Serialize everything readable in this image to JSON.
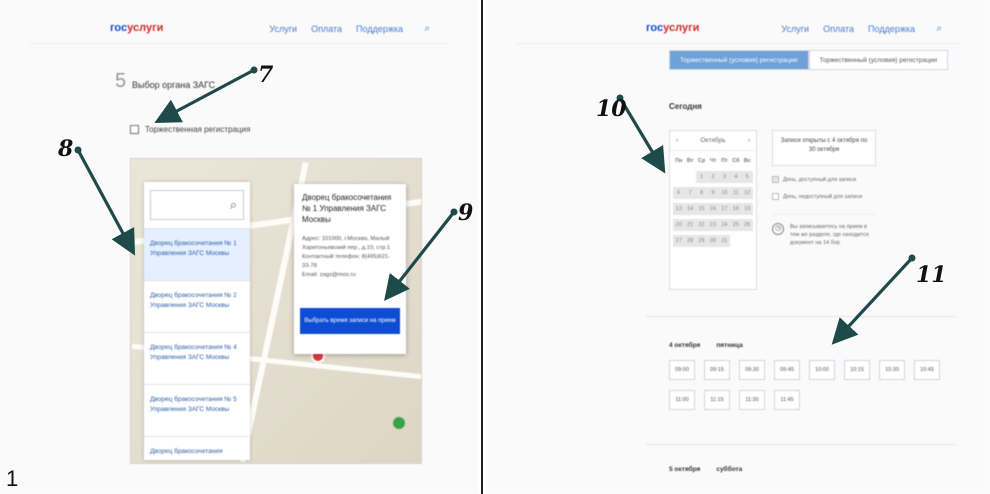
{
  "figure_label": "1",
  "colors": {
    "brand_blue": "#0d4cd3",
    "brand_red": "#d12c2c",
    "arrow": "#1f4a4a",
    "tab_active": "#6fa0d8"
  },
  "header": {
    "logo_prefix": "гос",
    "logo_suffix": "услуги",
    "nav": [
      "Услуги",
      "Оплата",
      "Поддержка"
    ],
    "search_icon": "search-icon"
  },
  "left": {
    "step_number": "5",
    "step_title": "Выбор органа ЗАГС",
    "checkbox_label": "Торжественная регистрация",
    "list_items": [
      "Дворец бракосочетания № 1 Управления ЗАГС Москвы",
      "Дворец бракосочетания № 2 Управления ЗАГС Москвы",
      "Дворец бракосочетания № 4 Управления ЗАГС Москвы",
      "Дворец бракосочетания № 5 Управления ЗАГС Москвы",
      "Дворец бракосочетания"
    ],
    "popup": {
      "title": "Дворец бракосочетания № 1 Управления ЗАГС Москвы",
      "lines": [
        "Адрес: 101000, г.Москва, Малый",
        "Харитоньевский пер., д.10, стр.1",
        "Контактный телефон: 8(495)621-33-78",
        "Email: zags@mos.ru"
      ],
      "button": "Выбрать время записи на прием"
    }
  },
  "right": {
    "tabs": [
      "Торжественный (условия) регистрации",
      "Торжественный (условия) регистрации"
    ],
    "section_label": "Сегодня",
    "calendar": {
      "month": "Октябрь",
      "weekdays": [
        "Пн",
        "Вт",
        "Ср",
        "Чт",
        "Пт",
        "Сб",
        "Вс"
      ],
      "days": [
        "",
        "",
        "1",
        "2",
        "3",
        "4",
        "5",
        "6",
        "7",
        "8",
        "9",
        "10",
        "11",
        "12",
        "13",
        "14",
        "15",
        "16",
        "17",
        "18",
        "19",
        "20",
        "21",
        "22",
        "23",
        "24",
        "25",
        "26",
        "27",
        "28",
        "29",
        "30",
        "31",
        "",
        ""
      ]
    },
    "info_box": "Записи открыты с 4 октября по 30 октября",
    "legend": [
      "День, доступный для записи",
      "День, недоступный для записи"
    ],
    "note": "Вы записываетесь на прием в тем же разделе, где находится документ на 14 бор",
    "date_row_1": [
      "4 октября",
      "пятница"
    ],
    "slots": [
      "09:00",
      "09:15",
      "09:30",
      "09:45",
      "10:00",
      "10:15",
      "10:30",
      "10:45",
      "11:00",
      "11:15",
      "11:30",
      "11:45"
    ],
    "date_row_2": [
      "5 октября",
      "суббота"
    ]
  },
  "annotations": [
    "7",
    "8",
    "9",
    "10",
    "11"
  ]
}
